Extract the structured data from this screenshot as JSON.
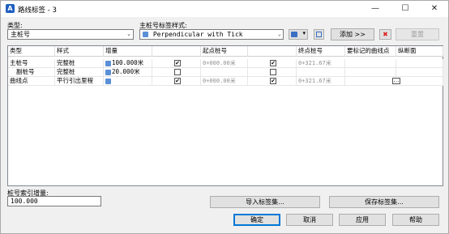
{
  "window": {
    "title": "路线标签 - 3",
    "minimize": "—",
    "maximize": "☐",
    "close": "✕"
  },
  "type_label": "类型:",
  "type_value": "主桩号",
  "style_label": "主桩号标签样式:",
  "style_value": "Perpendicular with Tick",
  "add_label": "添加 >>",
  "delete_label": "✖",
  "refresh_label": "重置",
  "columns": [
    "类型",
    "样式",
    "增量",
    "",
    "起点桩号",
    "",
    "终点桩号",
    "要标记的曲线点",
    "纵断面"
  ],
  "rows": [
    {
      "type": "主桩号",
      "style": "完整桩",
      "increment": "100.000米",
      "start": "0+000.00米",
      "end": "0+321.67米",
      "checked1": "✔",
      "checked2": "✔"
    },
    {
      "type": "副桩号",
      "style": "完整桩",
      "increment": "20.000米",
      "start": "",
      "end": "",
      "checked1": "",
      "checked2": ""
    },
    {
      "type": "曲线点",
      "style": "平行引出里程",
      "increment": "",
      "start": "0+000.00米",
      "end": "0+321.67米",
      "checked1": "✔",
      "checked2": "✔",
      "ellipsis": "…"
    }
  ],
  "station_inc_label": "桩号索引增量:",
  "station_inc_value": "100.000",
  "import_label": "导入标签集...",
  "save_set_label": "保存标签集...",
  "ok_label": "确定",
  "cancel_label": "取消",
  "apply_label": "应用",
  "help_label": "帮助",
  "colors": {
    "accent": "#0078d7",
    "delete_red": "#d22",
    "chip_blue": "#5b8fd6"
  }
}
